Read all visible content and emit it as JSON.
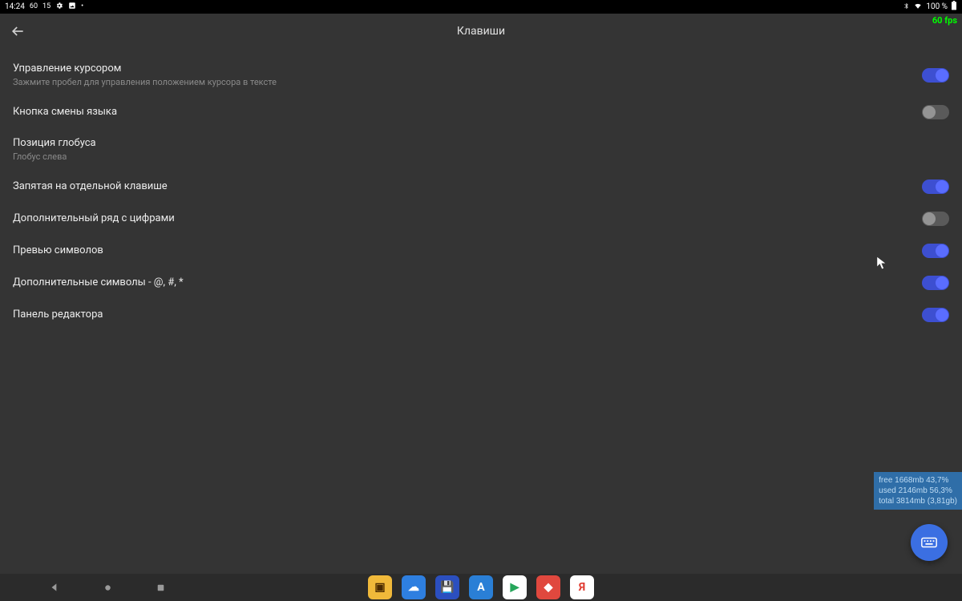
{
  "status": {
    "time": "14:24",
    "net": "60",
    "temp": "15",
    "battery": "100 %"
  },
  "fps": "60 fps",
  "header": {
    "title": "Клавиши"
  },
  "settings": [
    {
      "title": "Управление курсором",
      "sub": "Зажмите пробел для управления положением курсора в тексте",
      "toggle": "on"
    },
    {
      "title": "Кнопка смены языка",
      "sub": "",
      "toggle": "off"
    },
    {
      "title": "Позиция глобуса",
      "sub": "Глобус слева",
      "toggle": ""
    },
    {
      "title": "Запятая на отдельной клавише",
      "sub": "",
      "toggle": "on"
    },
    {
      "title": "Дополнительный ряд с цифрами",
      "sub": "",
      "toggle": "off"
    },
    {
      "title": "Превью символов",
      "sub": "",
      "toggle": "on"
    },
    {
      "title": "Дополнительные символы - @, #, *",
      "sub": "",
      "toggle": "on"
    },
    {
      "title": "Панель редактора",
      "sub": "",
      "toggle": "on"
    }
  ],
  "mem": {
    "line1": "free 1668mb 43,7%",
    "line2": "used 2146mb 56,3%",
    "line3": "total 3814mb (3,81gb)"
  },
  "dock": [
    {
      "name": "tv-app",
      "bg": "#f0b93a",
      "fg": "#4a2a00",
      "glyph": "▣"
    },
    {
      "name": "cloud-app",
      "bg": "#2e7fe0",
      "fg": "#fff",
      "glyph": "☁"
    },
    {
      "name": "save-app",
      "bg": "#2b4fbf",
      "fg": "#fff",
      "glyph": "💾"
    },
    {
      "name": "a-app",
      "bg": "#2a7fd6",
      "fg": "#fff",
      "glyph": "A"
    },
    {
      "name": "play-store",
      "bg": "#ffffff",
      "fg": "#26a65b",
      "glyph": "▶"
    },
    {
      "name": "anydesk",
      "bg": "#e0483e",
      "fg": "#fff",
      "glyph": "◆"
    },
    {
      "name": "yandex",
      "bg": "#ffffff",
      "fg": "#e03a2f",
      "glyph": "Я"
    }
  ]
}
